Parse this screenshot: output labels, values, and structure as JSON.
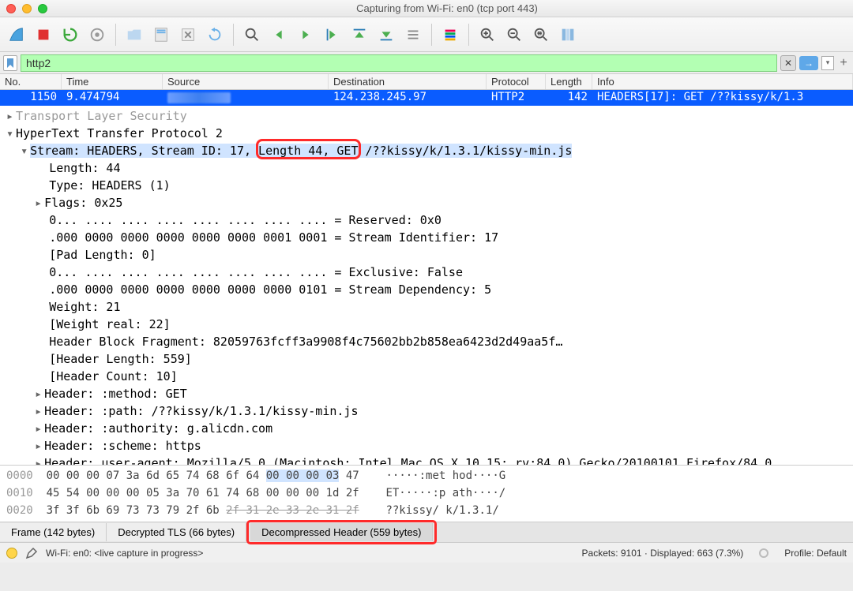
{
  "window": {
    "title": "Capturing from Wi-Fi: en0 (tcp port 443)"
  },
  "filter": {
    "value": "http2"
  },
  "columns": {
    "no": "No.",
    "time": "Time",
    "source": "Source",
    "destination": "Destination",
    "protocol": "Protocol",
    "length": "Length",
    "info": "Info"
  },
  "packet": {
    "no": "1150",
    "time": "9.474794",
    "destination": "124.238.245.97",
    "protocol": "HTTP2",
    "length": "142",
    "info": "HEADERS[17]: GET /??kissy/k/1.3"
  },
  "details": {
    "tls": "Transport Layer Security",
    "http2": "HyperText Transfer Protocol 2",
    "stream": "Stream: HEADERS, Stream ID: 17, Length 44, GET /??kissy/k/1.3.1/kissy-min.js",
    "length": "Length: 44",
    "type": "Type: HEADERS (1)",
    "flags": "Flags: 0x25",
    "reserved": "0... .... .... .... .... .... .... .... = Reserved: 0x0",
    "streamid": ".000 0000 0000 0000 0000 0000 0001 0001 = Stream Identifier: 17",
    "padlen": "[Pad Length: 0]",
    "exclusive": "0... .... .... .... .... .... .... .... = Exclusive: False",
    "streamdep": ".000 0000 0000 0000 0000 0000 0000 0101 = Stream Dependency: 5",
    "weight": "Weight: 21",
    "weightreal": "[Weight real: 22]",
    "hblock": "Header Block Fragment: 82059763fcff3a9908f4c75602bb2b858ea6423d2d49aa5f…",
    "hlen": "[Header Length: 559]",
    "hcount": "[Header Count: 10]",
    "h_method": "Header: :method: GET",
    "h_path": "Header: :path: /??kissy/k/1.3.1/kissy-min.js",
    "h_auth": "Header: :authority: g.alicdn.com",
    "h_scheme": "Header: :scheme: https",
    "h_ua": "Header: user-agent: Mozilla/5.0 (Macintosh; Intel Mac OS X 10.15; rv:84.0) Gecko/20100101 Firefox/84.0"
  },
  "hex": {
    "r0": {
      "off": "0000",
      "bytes": "00 00 00 07 3a 6d 65 74  68 6f 64 00 00 00 03 47",
      "ascii": "·····:met hod····G",
      "hilite_start": 11,
      "hilite_end": 15
    },
    "r1": {
      "off": "0010",
      "bytes": "45 54 00 00 00 05 3a 70  61 74 68 00 00 00 1d 2f",
      "ascii": "ET·····:p ath····/"
    },
    "r2": {
      "off": "0020",
      "bytes": "3f 3f 6b 69 73 73 79 2f  6b 2f 31 2e 33 2e 31 2f",
      "ascii": "??kissy/ k/1.3.1/"
    }
  },
  "tabs": {
    "frame": "Frame (142 bytes)",
    "tls": "Decrypted TLS (66 bytes)",
    "header": "Decompressed Header (559 bytes)"
  },
  "status": {
    "capture": "Wi-Fi: en0: <live capture in progress>",
    "packets": "Packets: 9101 · Displayed: 663 (7.3%)",
    "profile": "Profile: Default"
  }
}
